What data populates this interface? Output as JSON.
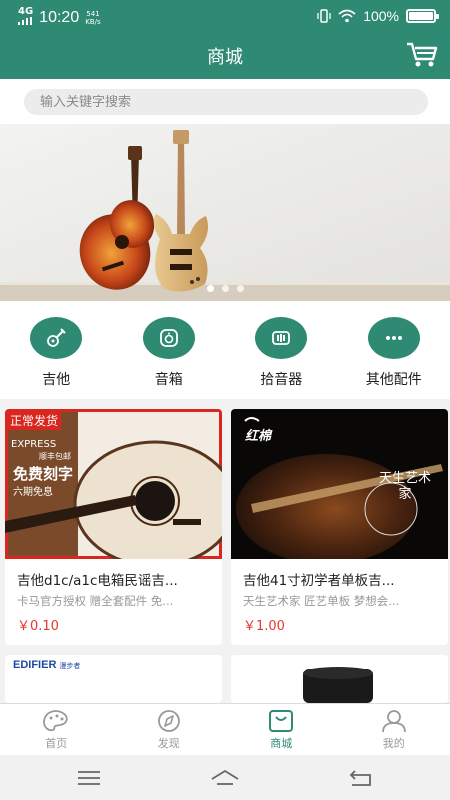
{
  "status_bar": {
    "network": "4G",
    "time": "10:20",
    "speed_value": "541",
    "speed_unit": "KB/s",
    "battery": "100%",
    "battery_level": 1.0
  },
  "header": {
    "title": "商城",
    "cart_icon": "cart-icon"
  },
  "search": {
    "placeholder": "输入关键字搜索"
  },
  "banner": {
    "slide_count": 3,
    "active_index": 0
  },
  "categories": [
    {
      "label": "吉他",
      "icon": "guitar-icon"
    },
    {
      "label": "音箱",
      "icon": "speaker-icon"
    },
    {
      "label": "拾音器",
      "icon": "pickup-icon"
    },
    {
      "label": "其他配件",
      "icon": "more-icon"
    }
  ],
  "products": [
    {
      "title": "吉他d1c/a1c电箱民谣吉...",
      "subtitle": "卡马官方授权 赠全套配件 免...",
      "price": "￥0.10",
      "badge": "正常发货",
      "promo_line1": "免费刻字",
      "promo_line2": "六期免息",
      "promo_brand": "EXPRESS",
      "promo_sub": "顺丰包邮"
    },
    {
      "title": "吉他41寸初学者单板吉...",
      "subtitle": "天生艺术家 匠艺单板 梦想会...",
      "price": "￥1.00",
      "logo_text": "红棉",
      "seal_text": "天生艺术家"
    },
    {
      "brand": "EDIFIER",
      "brand_sub": "漫步者"
    },
    {}
  ],
  "tabbar": [
    {
      "label": "首页",
      "icon": "palette-icon",
      "active": false
    },
    {
      "label": "发现",
      "icon": "compass-icon",
      "active": false
    },
    {
      "label": "商城",
      "icon": "bag-icon",
      "active": true
    },
    {
      "label": "我的",
      "icon": "person-icon",
      "active": false
    }
  ],
  "colors": {
    "brand": "#2f8a73",
    "price": "#e03a2f",
    "badge": "#d8271f"
  }
}
